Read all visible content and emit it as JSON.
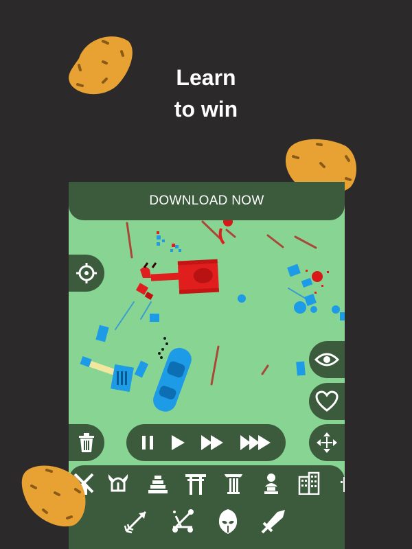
{
  "headline": {
    "line1": "Learn",
    "line2": "to win"
  },
  "download_label": "DOWNLOAD NOW",
  "colors": {
    "background": "#2b292a",
    "field": "#87d493",
    "panel": "#3c5a3c",
    "red_team": "#e01e1e",
    "blue_team": "#1e9be6",
    "potato": "#e8a233"
  },
  "controls": {
    "left": [
      "target-icon",
      "trash-icon"
    ],
    "right": [
      "eye-icon",
      "heart-icon",
      "move-arrows-icon"
    ],
    "playback": [
      "pause-icon",
      "play-icon",
      "fast-forward-icon",
      "fastest-forward-icon"
    ]
  },
  "palette": {
    "row1": [
      "windmill-icon",
      "viking-helmet-icon",
      "pyramid-icon",
      "torii-gate-icon",
      "greek-column-icon",
      "bust-icon",
      "buildings-icon",
      "scroll-more-icon"
    ],
    "row2": [
      "arrow-icon",
      "catapult-icon",
      "knight-helmet-icon",
      "sword-icon"
    ]
  }
}
